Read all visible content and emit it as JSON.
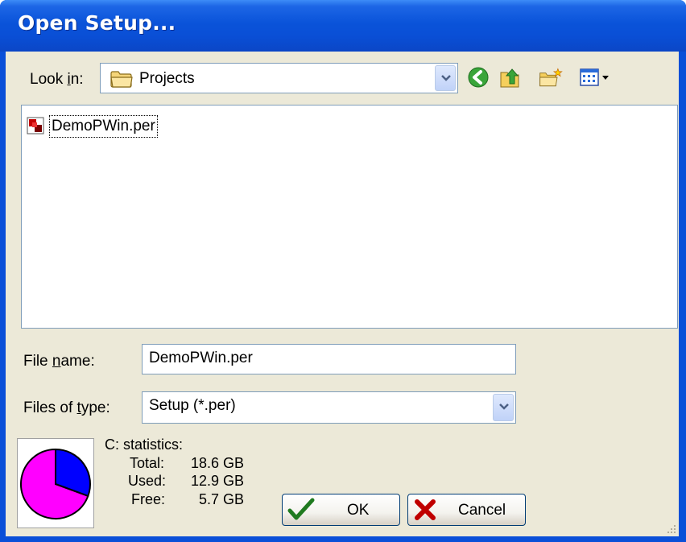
{
  "window": {
    "title": "Open Setup..."
  },
  "look_in": {
    "label_prefix": "Look ",
    "label_accel": "i",
    "label_suffix": "n:",
    "value": "Projects",
    "icon": "folder-icon"
  },
  "toolbar": {
    "back_icon": "back-arrow-icon",
    "up_icon": "up-one-level-icon",
    "new_folder_icon": "new-folder-icon",
    "view_icon": "view-menu-icon"
  },
  "files": [
    {
      "name": "DemoPWin.per",
      "icon": "setup-file-icon"
    }
  ],
  "file_name": {
    "label_prefix": "File ",
    "label_accel": "n",
    "label_suffix": "ame:",
    "value": "DemoPWin.per"
  },
  "file_type": {
    "label_prefix": "Files of ",
    "label_accel": "t",
    "label_suffix": "ype:",
    "value": "Setup (*.per)"
  },
  "stats": {
    "heading": "C: statistics:",
    "rows": [
      {
        "label": "Total:",
        "value": "18.6 GB"
      },
      {
        "label": "Used:",
        "value": "12.9 GB"
      },
      {
        "label": "Free:",
        "value": "5.7 GB"
      }
    ],
    "used_fraction": 0.694,
    "used_color": "#ff00ff",
    "free_color": "#0000ff"
  },
  "buttons": {
    "ok_label": "OK",
    "cancel_label": "Cancel"
  }
}
